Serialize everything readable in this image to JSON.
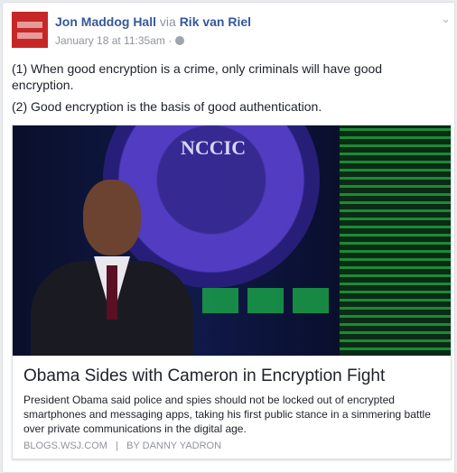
{
  "post": {
    "author": "Jon Maddog Hall",
    "via_label": "via",
    "via_author": "Rik van Riel",
    "timestamp": "January 18 at 11:35am",
    "separator": "·",
    "privacy_icon": "globe-icon",
    "paragraphs": [
      "(1) When good encryption is a crime, only criminals will have good encryption.",
      "(2) Good encryption is the basis of good authentication."
    ]
  },
  "link": {
    "image_logo_text": "NCCIC",
    "title": "Obama Sides with Cameron in Encryption Fight",
    "description": "President Obama said police and spies should not be locked out of encrypted smartphones and messaging apps, taking his first public stance in a simmering battle over private communications in the digital age.",
    "domain": "BLOGS.WSJ.COM",
    "divider": "|",
    "byline": "BY DANNY YADRON"
  }
}
